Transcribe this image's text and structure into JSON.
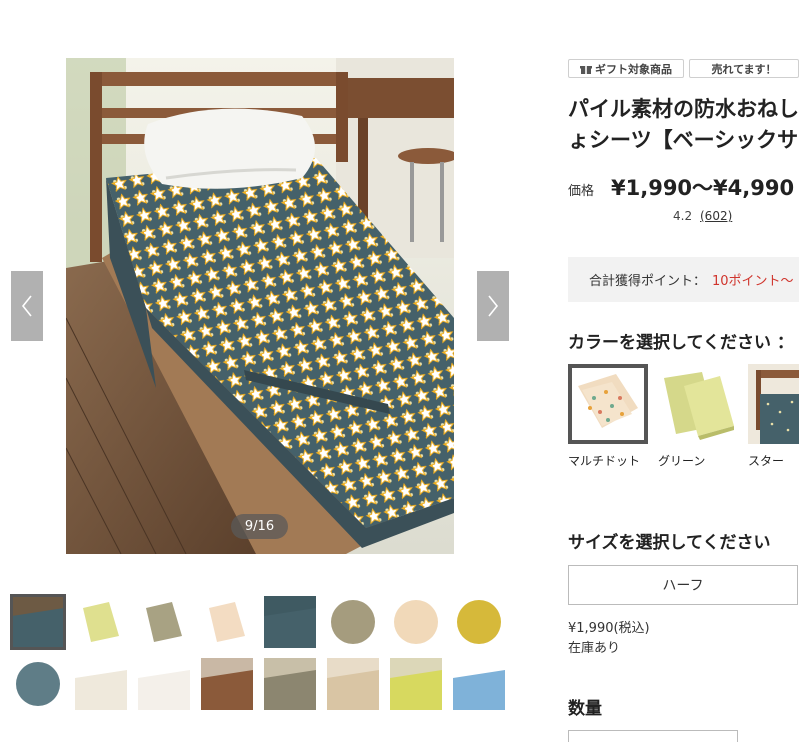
{
  "gallery": {
    "counter": "9/16",
    "thumbnails": [
      "thumb-bed-star",
      "thumb-green-folded",
      "thumb-khaki-folded",
      "thumb-multidot-folded",
      "thumb-star-navy",
      "thumb-khaki-round",
      "thumb-multidot-round",
      "thumb-yellow-round",
      "thumb-star-round",
      "thumb-size-chart",
      "thumb-feature-chart",
      "thumb-bed-lifestyle",
      "thumb-khaki-bed",
      "thumb-beige-bed",
      "thumb-green-bed",
      "thumb-waterproof-demo"
    ],
    "selected_index": 0
  },
  "badges": {
    "gift": "ギフト対象商品",
    "sold": "売れてます！"
  },
  "product": {
    "title": "パイル素材の防水おねしょシーツ【ベーシックサイズ・ベッドパッド・ラグ】",
    "price_label": "価格",
    "price": "¥1,990〜¥4,990",
    "rating": 4.2,
    "rating_text": "4.2",
    "reviews": "(602)"
  },
  "points": {
    "label": "合計獲得ポイント：",
    "value": "10ポイント〜"
  },
  "color_section": {
    "title": "カラーを選択してください ：",
    "options": [
      {
        "label": "マルチドット",
        "selected": true
      },
      {
        "label": "グリーン",
        "selected": false
      },
      {
        "label": "スター",
        "selected": false
      }
    ]
  },
  "size_section": {
    "title": "サイズを選択してください",
    "selected": "ハーフ",
    "price_tax": "¥1,990(税込)",
    "stock": "在庫あり"
  },
  "quantity": {
    "title": "数量"
  },
  "colors": {
    "accent_red": "#d0342c",
    "star_gold": "#f2b01e",
    "sheet_navy": "#45616a"
  }
}
